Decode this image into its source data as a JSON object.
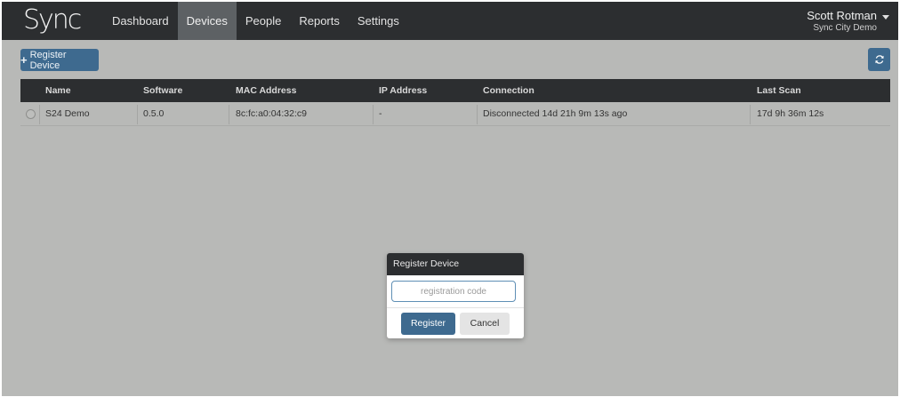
{
  "brand": {
    "logo_text": "Sync"
  },
  "nav": {
    "items": [
      {
        "label": "Dashboard",
        "active": false
      },
      {
        "label": "Devices",
        "active": true
      },
      {
        "label": "People",
        "active": false
      },
      {
        "label": "Reports",
        "active": false
      },
      {
        "label": "Settings",
        "active": false
      }
    ]
  },
  "user": {
    "name": "Scott Rotman",
    "org": "Sync City Demo"
  },
  "toolbar": {
    "register_device_label": "Register Device",
    "refresh_icon": "refresh-icon"
  },
  "table": {
    "headers": [
      "Name",
      "Software",
      "MAC Address",
      "IP Address",
      "Connection",
      "Last Scan"
    ],
    "rows": [
      {
        "name": "S24 Demo",
        "software": "0.5.0",
        "mac": "8c:fc:a0:04:32:c9",
        "ip": "-",
        "connection": "Disconnected 14d 21h 9m 13s ago",
        "last_scan": "17d 9h 36m 12s"
      }
    ]
  },
  "modal": {
    "title": "Register Device",
    "input_placeholder": "registration code",
    "input_value": "",
    "register_label": "Register",
    "cancel_label": "Cancel"
  },
  "colors": {
    "navbar": "#2c2e30",
    "primary_button": "#3e6a8f",
    "overlay_background": "#b8b9b7"
  }
}
